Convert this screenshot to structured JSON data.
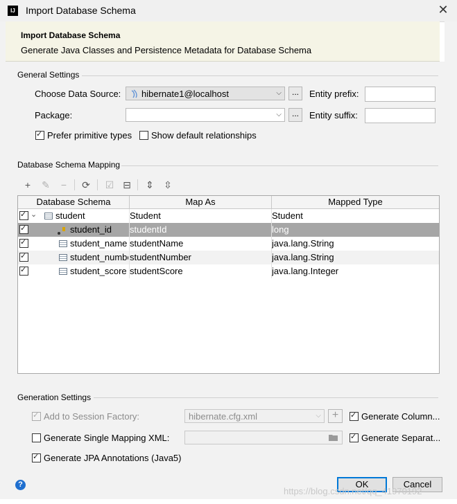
{
  "window": {
    "title": "Import Database Schema",
    "close_glyph": "✕",
    "logo_text": "IJ"
  },
  "header": {
    "title": "Import Database Schema",
    "subtitle": "Generate Java Classes and Persistence Metadata for Database Schema"
  },
  "general": {
    "section": "General Settings",
    "data_source_label": "Choose Data Source:",
    "data_source_value": "hibernate1@localhost",
    "package_label": "Package:",
    "package_value": "",
    "browse_label": "...",
    "entity_prefix_label": "Entity prefix:",
    "entity_prefix_value": "",
    "entity_suffix_label": "Entity suffix:",
    "entity_suffix_value": "",
    "prefer_primitive_label": "Prefer primitive types",
    "prefer_primitive_checked": true,
    "show_default_rel_label": "Show default relationships",
    "show_default_rel_checked": false
  },
  "mapping": {
    "section": "Database Schema Mapping",
    "toolbar": [
      "add-icon",
      "edit-icon",
      "remove-icon",
      "refresh-icon",
      "check-icon",
      "collapse-box-icon",
      "expand-all-icon",
      "collapse-all-icon"
    ],
    "columns": [
      "Database Schema",
      "Map As",
      "Mapped Type"
    ],
    "rows": [
      {
        "name": "student",
        "map_as": "Student",
        "type": "Student",
        "checked": true
      },
      {
        "name": "student_id",
        "map_as": "studentId",
        "type": "long",
        "checked": true
      },
      {
        "name": "student_name",
        "map_as": "studentName",
        "type": "java.lang.String",
        "checked": true
      },
      {
        "name": "student_number",
        "map_as": "studentNumber",
        "type": "java.lang.String",
        "checked": true
      },
      {
        "name": "student_score",
        "map_as": "studentScore",
        "type": "java.lang.Integer",
        "checked": true
      }
    ]
  },
  "generation": {
    "section": "Generation Settings",
    "add_to_factory_label": "Add to Session Factory:",
    "factory_value": "hibernate.cfg.xml",
    "generate_columns_label": "Generate Column...",
    "single_mapping_label": "Generate Single Mapping XML:",
    "generate_separate_label": "Generate Separat...",
    "jpa_label": "Generate JPA Annotations (Java5)"
  },
  "buttons": {
    "ok": "OK",
    "cancel": "Cancel",
    "help": "?"
  },
  "watermark": "https://blog.csdn.net/qq_41970192"
}
